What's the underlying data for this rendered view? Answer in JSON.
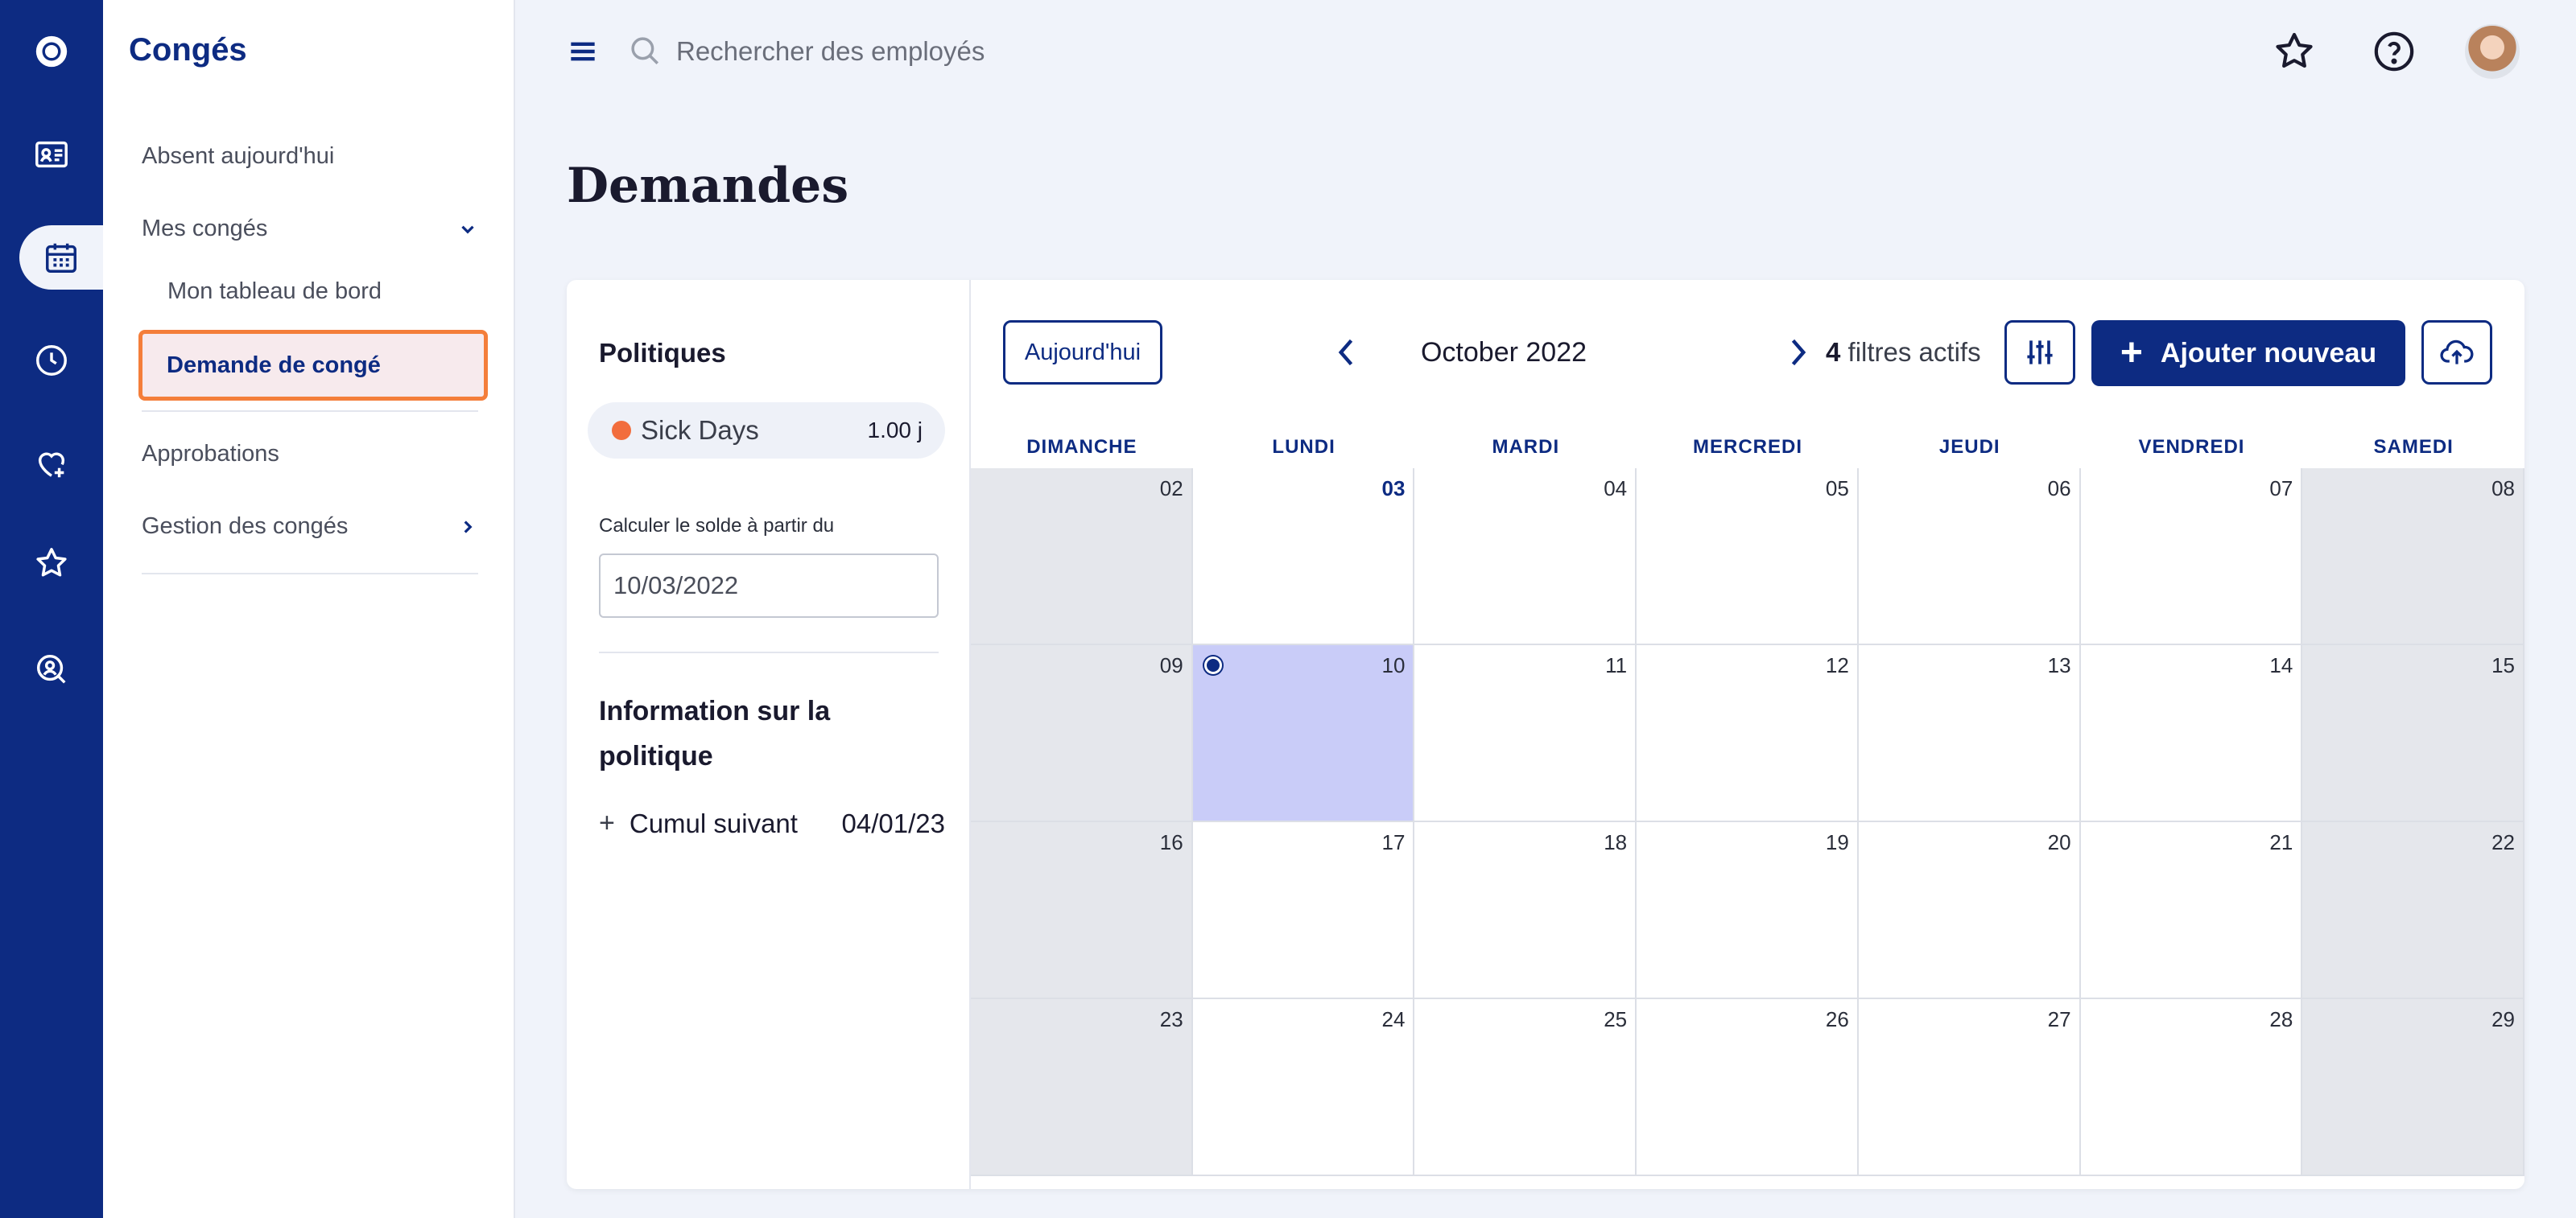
{
  "app": {
    "title": "Congés"
  },
  "rail": {
    "icons": [
      "logo-icon",
      "id-card-icon",
      "calendar-icon",
      "clock-icon",
      "heart-icon",
      "star-icon",
      "search-person-icon"
    ]
  },
  "sidebar": {
    "items": [
      {
        "label": "Absent aujourd'hui"
      },
      {
        "label": "Mes congés"
      },
      {
        "label": "Mon tableau de bord"
      },
      {
        "label": "Demande de congé"
      },
      {
        "label": "Approbations"
      },
      {
        "label": "Gestion des congés"
      }
    ]
  },
  "search": {
    "placeholder": "Rechercher des employés"
  },
  "page": {
    "title": "Demandes"
  },
  "policies": {
    "title": "Politiques",
    "policy_name": "Sick Days",
    "policy_value": "1.00 j",
    "calc_label": "Calculer le solde à partir du",
    "calc_date": "10/03/2022",
    "info_title": "Information sur la politique",
    "cumul_label": "Cumul suivant",
    "cumul_date": "04/01/23"
  },
  "calendar": {
    "today_label": "Aujourd'hui",
    "month": "October 2022",
    "filters_count": "4",
    "filters_label": "filtres actifs",
    "add_label": "Ajouter nouveau",
    "weekdays": [
      "DIMANCHE",
      "LUNDI",
      "MARDI",
      "MERCREDI",
      "JEUDI",
      "VENDREDI",
      "SAMEDI"
    ],
    "weeks": [
      [
        "02",
        "03",
        "04",
        "05",
        "06",
        "07",
        "08"
      ],
      [
        "09",
        "10",
        "11",
        "12",
        "13",
        "14",
        "15"
      ],
      [
        "16",
        "17",
        "18",
        "19",
        "20",
        "21",
        "22"
      ],
      [
        "23",
        "24",
        "25",
        "26",
        "27",
        "28",
        "29"
      ]
    ],
    "today_date": "03",
    "selected_date": "10"
  },
  "colors": {
    "brand": "#0d2b82",
    "selected_cell": "#c9ccf8",
    "highlight_border": "#f47e3a",
    "policy_dot": "#f26d3d"
  }
}
